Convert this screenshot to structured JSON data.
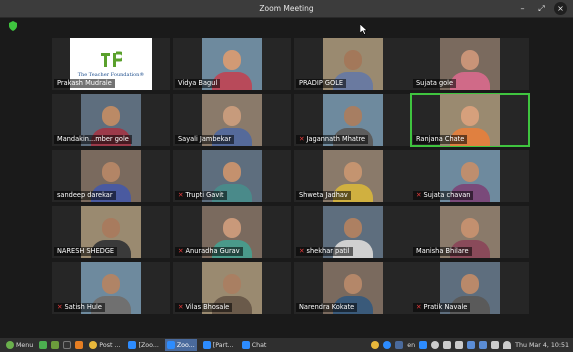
{
  "window": {
    "title": "Zoom Meeting",
    "minimize": "–",
    "maximize": "⤢",
    "close": "×"
  },
  "logo": {
    "caption": "The Teacher Foundation®"
  },
  "participants": [
    {
      "name": "Prakash Mudrale",
      "muted": false,
      "active": false
    },
    {
      "name": "Vidya Bagul",
      "muted": false,
      "active": false
    },
    {
      "name": "PRADIP GOLE",
      "muted": false,
      "active": false
    },
    {
      "name": "Sujata gole",
      "muted": false,
      "active": false
    },
    {
      "name": "Mandakin...mber gole",
      "muted": false,
      "active": false
    },
    {
      "name": "Sayali Jambekar",
      "muted": false,
      "active": false
    },
    {
      "name": "Jagannath Mhatre",
      "muted": true,
      "active": false
    },
    {
      "name": "Ranjana Chate",
      "muted": false,
      "active": true
    },
    {
      "name": "sandeep darekar",
      "muted": false,
      "active": false
    },
    {
      "name": "Trupti Gavit",
      "muted": true,
      "active": false
    },
    {
      "name": "Shweta Jadhav",
      "muted": false,
      "active": false
    },
    {
      "name": "Sujata chavan",
      "muted": true,
      "active": false
    },
    {
      "name": "NARESH SHEDGE",
      "muted": false,
      "active": false
    },
    {
      "name": "Anuradha Gurav",
      "muted": true,
      "active": false
    },
    {
      "name": "shekhar patil",
      "muted": true,
      "active": false
    },
    {
      "name": "Manisha Bhilare",
      "muted": false,
      "active": false
    },
    {
      "name": "Satish Hule",
      "muted": true,
      "active": false
    },
    {
      "name": "Vilas Bhosale",
      "muted": true,
      "active": false
    },
    {
      "name": "Narendra Kokate",
      "muted": false,
      "active": false
    },
    {
      "name": "Pratik Navale",
      "muted": true,
      "active": false
    }
  ],
  "taskbar": {
    "menu": "Menu",
    "apps": [
      "Post ...",
      "[Zoo...",
      "Zoo...",
      "[Part...",
      "Chat"
    ],
    "tray": {
      "keyboard": "en",
      "datetime": "Thu Mar 4, 10:51"
    }
  },
  "colors": {
    "active_border": "#3fc43f",
    "mute": "#e23b3b",
    "taskbar": "#2f2f2f"
  }
}
